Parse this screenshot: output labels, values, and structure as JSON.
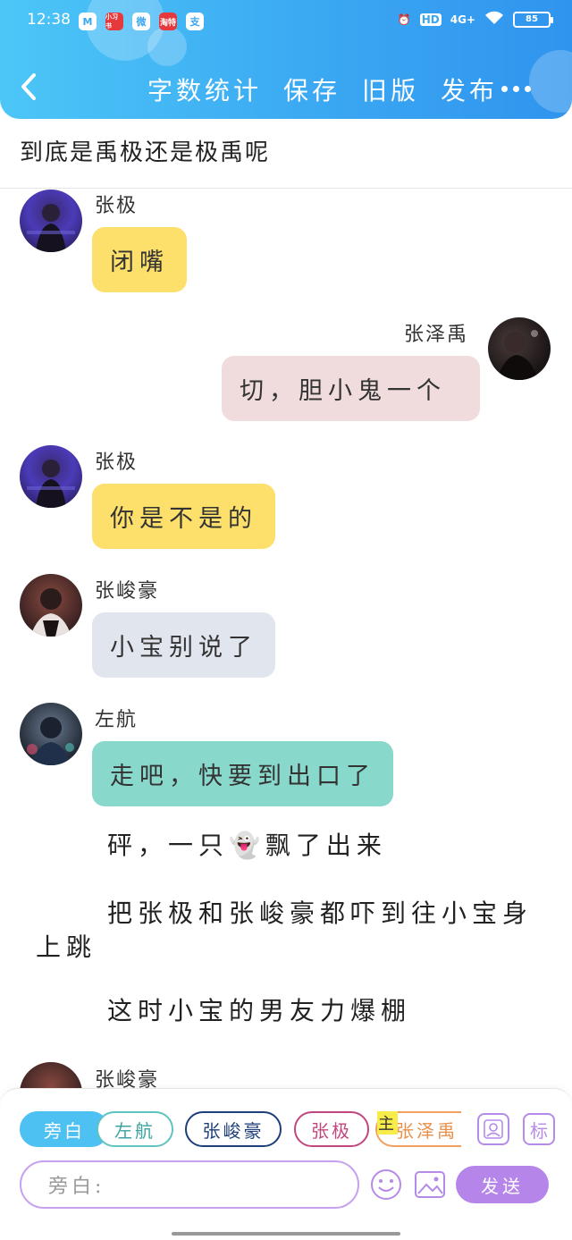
{
  "status": {
    "time": "12:38",
    "network": "4G+",
    "hd": "HD",
    "battery": "85",
    "apps": [
      "M",
      "小习书",
      "微",
      "淘特",
      "支"
    ]
  },
  "nav": {
    "items": [
      "字数统计",
      "保存",
      "旧版",
      "发布"
    ]
  },
  "story_title": "到底是禹极还是极禹呢",
  "messages": [
    {
      "speaker": "张极",
      "text": "闭嘴",
      "side": "left",
      "color": "#fddf6b"
    },
    {
      "speaker": "张泽禹",
      "text": "切，胆小鬼一个",
      "side": "right",
      "color": "#f0dcdc"
    },
    {
      "speaker": "张极",
      "text": "你是不是的",
      "side": "left",
      "color": "#fddf6b"
    },
    {
      "speaker": "张峻豪",
      "text": "小宝别说了",
      "side": "left",
      "color": "#e1e5ee"
    },
    {
      "speaker": "左航",
      "text": "走吧，快要到出口了",
      "side": "left",
      "color": "#89d8cc"
    }
  ],
  "narration": {
    "line1_before": "砰，一只",
    "ghost": "👻",
    "line1_after": "飘了出来",
    "line2": "把张极和张峻豪都吓到往小宝身上跳",
    "line3": "这时小宝的男友力爆棚"
  },
  "partial_speaker": "张峻豪",
  "characters": [
    {
      "name": "旁白",
      "color": "#4ec1f3",
      "active": true
    },
    {
      "name": "左航",
      "color": "#5fc4c0",
      "active": false
    },
    {
      "name": "张峻豪",
      "color": "#1e3f7a",
      "active": false
    },
    {
      "name": "张极",
      "color": "#c2477f",
      "active": false
    },
    {
      "name": "张泽禹",
      "color": "#f0a060",
      "active": false,
      "main_badge": "主"
    }
  ],
  "side_buttons": {
    "person": "人",
    "tag": "标"
  },
  "input": {
    "placeholder": "旁白:"
  },
  "send_label": "发送"
}
